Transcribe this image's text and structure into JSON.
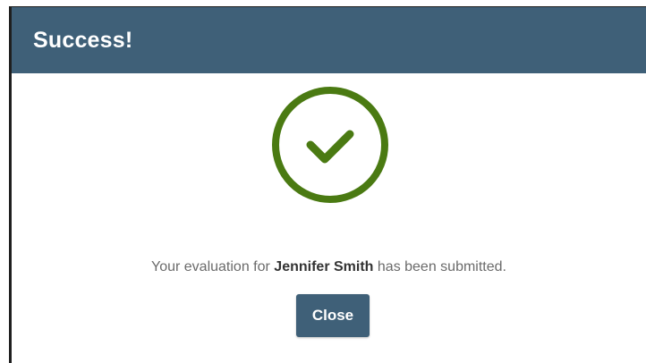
{
  "dialog": {
    "title": "Success!",
    "icon": "check-circle-icon",
    "message_prefix": "Your evaluation for",
    "person_name": "Jennifer Smith",
    "message_suffix": "has been submitted.",
    "close_label": "Close"
  },
  "colors": {
    "header_bg": "#3f6078",
    "button_bg": "#3f6078",
    "check_green": "#4a7a12",
    "text_gray": "#6b6b6b"
  }
}
